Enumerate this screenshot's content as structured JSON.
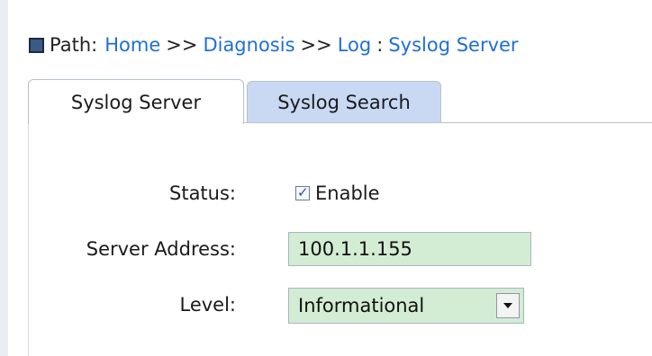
{
  "breadcrumb": {
    "label": "Path:",
    "home": "Home",
    "sep1": ">>",
    "diagnosis": "Diagnosis",
    "sep2": ">>",
    "log": "Log",
    "colon": ":",
    "current": "Syslog Server"
  },
  "tabs": [
    {
      "label": "Syslog Server"
    },
    {
      "label": "Syslog Search"
    }
  ],
  "form": {
    "status": {
      "label": "Status:",
      "checkbox_label": "Enable",
      "checked": true
    },
    "server_address": {
      "label": "Server Address:",
      "value": "100.1.1.155"
    },
    "level": {
      "label": "Level:",
      "value": "Informational"
    }
  }
}
